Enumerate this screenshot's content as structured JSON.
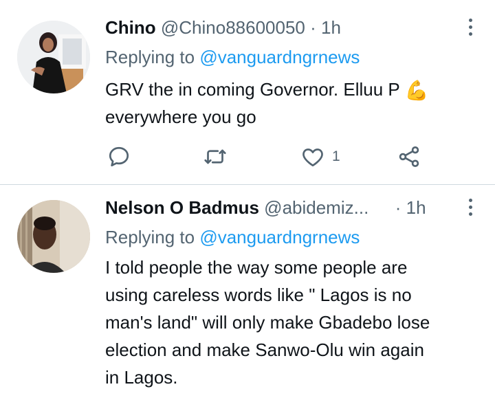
{
  "tweets": [
    {
      "name": "Chino",
      "handle": "@Chino88600050",
      "separator": "·",
      "time": "1h",
      "replying_label": "Replying to",
      "replying_to": "@vanguardngrnews",
      "text_line1": "GRV the in coming Governor. Elluu P",
      "emoji": "💪",
      "text_line2": "everywhere you go",
      "actions": {
        "reply_icon": "reply-icon",
        "retweet_icon": "retweet-icon",
        "like_icon": "heart-icon",
        "like_count": "1",
        "share_icon": "share-icon"
      }
    },
    {
      "name": "Nelson O Badmus",
      "handle": "@abidemiz...",
      "separator": "·",
      "time": "1h",
      "replying_label": "Replying to",
      "replying_to": "@vanguardngrnews",
      "text_lines": [
        "I told people the way some people are",
        "using careless words like \" Lagos is no",
        "man's land\" will only make Gbadebo lose",
        "election and make Sanwo-Olu win again",
        "in Lagos."
      ]
    }
  ],
  "colors": {
    "text": "#0f1419",
    "secondary": "#536471",
    "link": "#1d9bf0",
    "divider": "#cfd9de"
  }
}
